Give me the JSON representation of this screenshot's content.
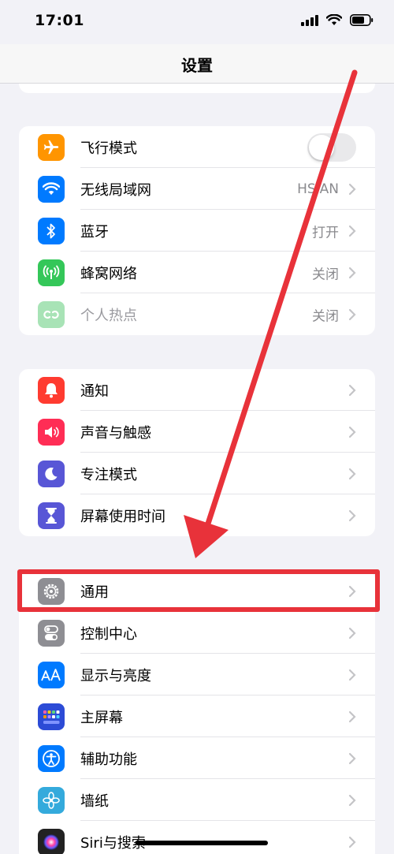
{
  "status_bar": {
    "time": "17:01"
  },
  "nav": {
    "title": "设置"
  },
  "groups": [
    {
      "rows": [
        {
          "label": "飞行模式",
          "icon": "airplane-icon",
          "color": "#ff9500",
          "toggle": "off"
        },
        {
          "label": "无线局域网",
          "icon": "wifi-icon",
          "color": "#007aff",
          "value": "HSIAN"
        },
        {
          "label": "蓝牙",
          "icon": "bluetooth-icon",
          "color": "#007aff",
          "value": "打开"
        },
        {
          "label": "蜂窝网络",
          "icon": "cellular-icon",
          "color": "#34c759",
          "value": "关闭"
        },
        {
          "label": "个人热点",
          "icon": "hotspot-icon",
          "color": "#a8e3b6",
          "value": "关闭",
          "disabled": true
        }
      ]
    },
    {
      "rows": [
        {
          "label": "通知",
          "icon": "bell-icon",
          "color": "#ff3b30"
        },
        {
          "label": "声音与触感",
          "icon": "speaker-icon",
          "color": "#ff2d55"
        },
        {
          "label": "专注模式",
          "icon": "moon-icon",
          "color": "#5856d6"
        },
        {
          "label": "屏幕使用时间",
          "icon": "hourglass-icon",
          "color": "#5856d6"
        }
      ]
    },
    {
      "rows": [
        {
          "label": "通用",
          "icon": "gear-icon",
          "color": "#8e8e93",
          "highlighted": true
        },
        {
          "label": "控制中心",
          "icon": "switches-icon",
          "color": "#8e8e93"
        },
        {
          "label": "显示与亮度",
          "icon": "text-size-icon",
          "color": "#007aff"
        },
        {
          "label": "主屏幕",
          "icon": "home-grid-icon",
          "color": "#2c4bd6"
        },
        {
          "label": "辅助功能",
          "icon": "accessibility-icon",
          "color": "#007aff"
        },
        {
          "label": "墙纸",
          "icon": "flower-icon",
          "color": "#34aadc"
        },
        {
          "label": "Siri与搜索",
          "icon": "siri-icon",
          "color": "#222222"
        }
      ]
    }
  ],
  "annotation": {
    "arrow_color": "#e8323a",
    "box_color": "#e8323a"
  }
}
